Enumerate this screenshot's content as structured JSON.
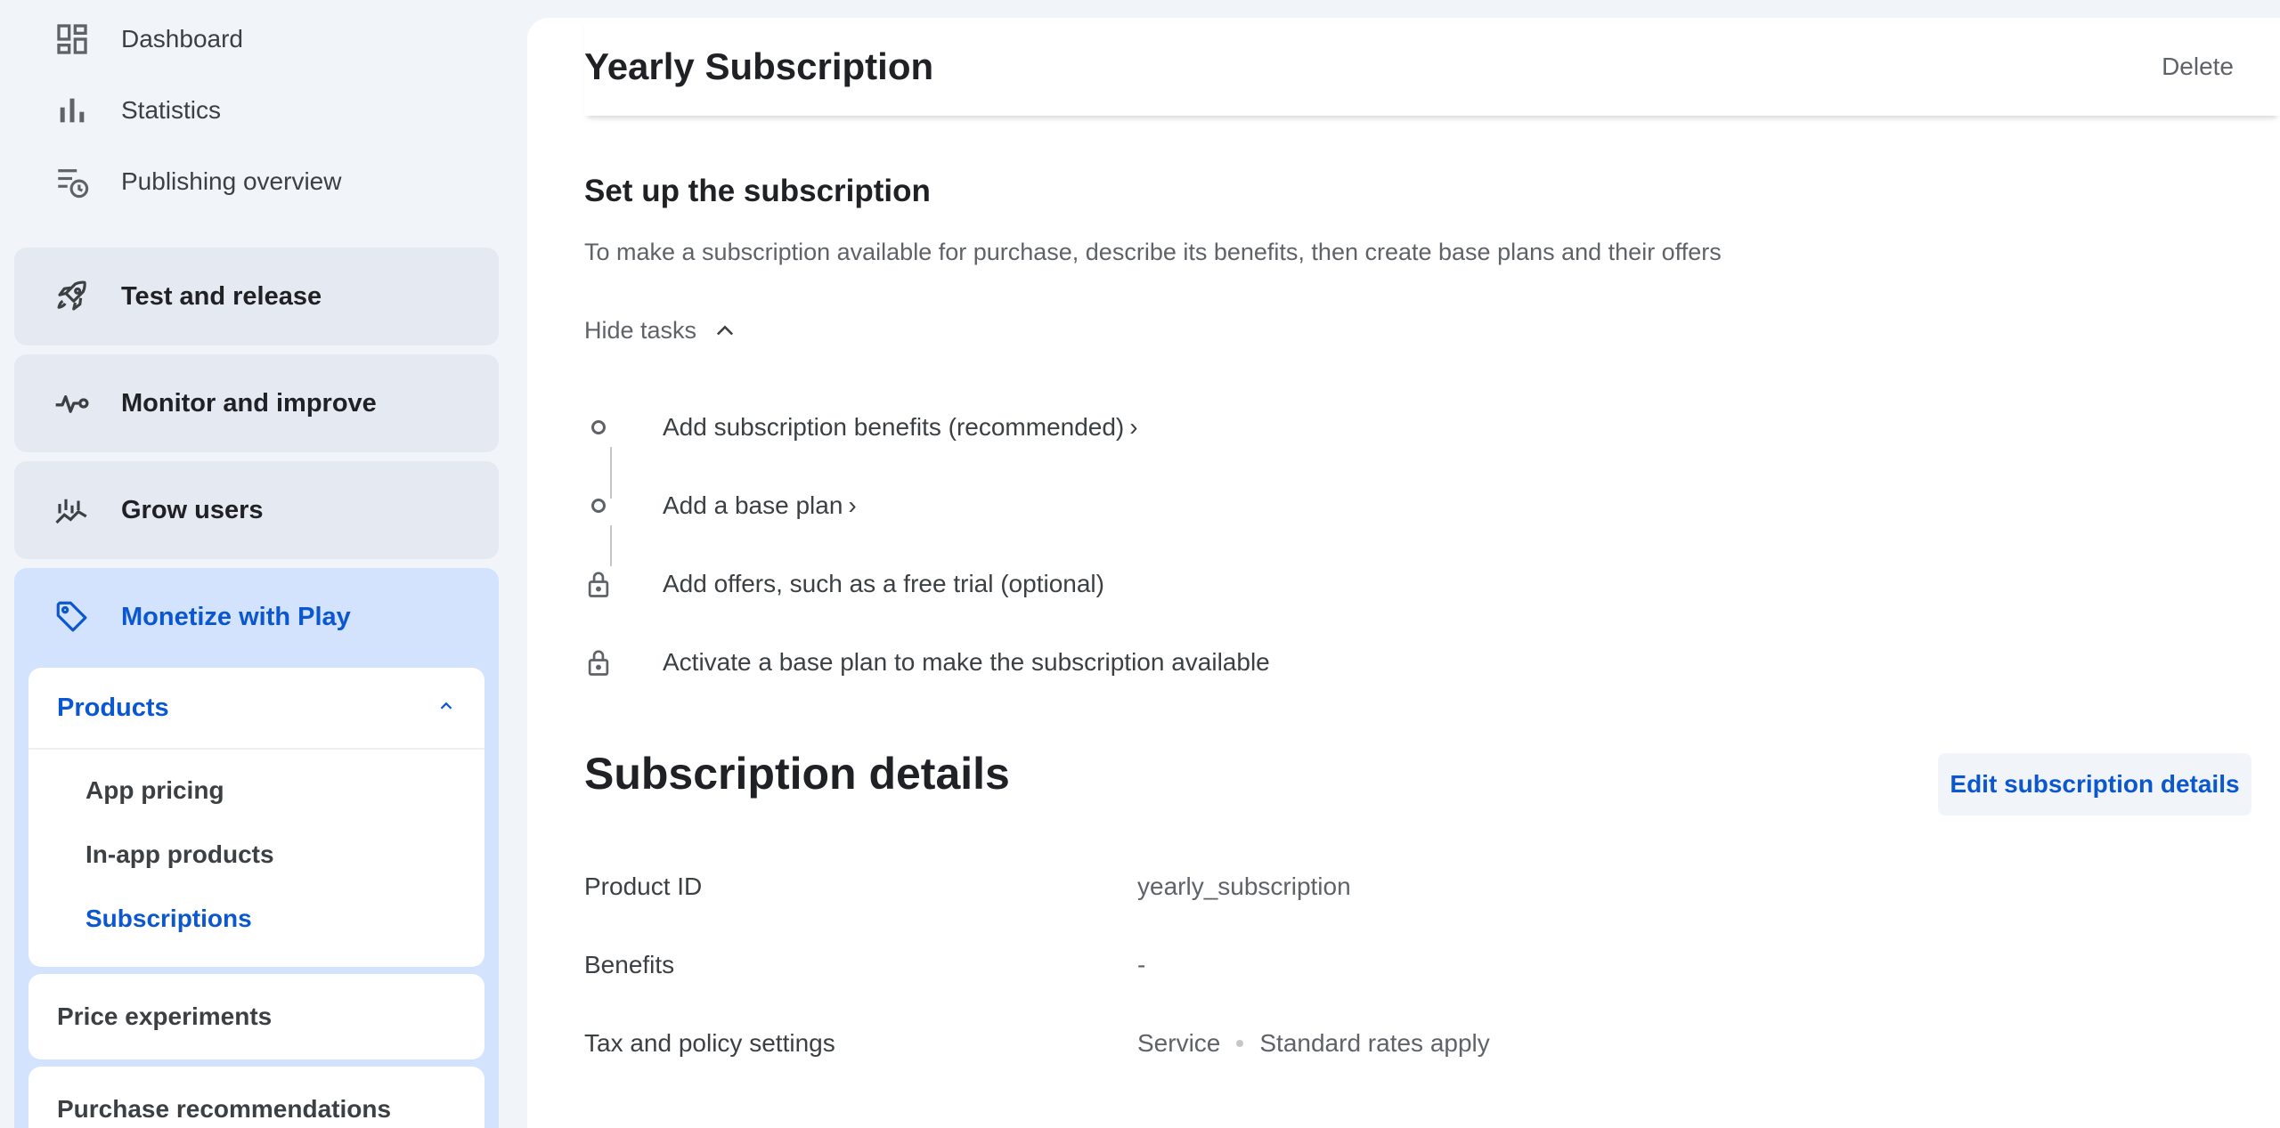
{
  "sidebar": {
    "top_items": [
      {
        "label": "Dashboard",
        "icon": "dashboard-icon"
      },
      {
        "label": "Statistics",
        "icon": "bar-chart-icon"
      },
      {
        "label": "Publishing overview",
        "icon": "publishing-history-icon"
      }
    ],
    "groups": [
      {
        "label": "Test and release",
        "icon": "rocket-icon"
      },
      {
        "label": "Monitor and improve",
        "icon": "pulse-icon"
      },
      {
        "label": "Grow users",
        "icon": "growth-chart-icon"
      },
      {
        "label": "Monetize with Play",
        "icon": "tag-icon"
      }
    ],
    "products": {
      "label": "Products",
      "items": [
        "App pricing",
        "In-app products",
        "Subscriptions"
      ],
      "selected": "Subscriptions"
    },
    "price_experiments": "Price experiments",
    "purchase_recommendations": "Purchase recommendations"
  },
  "header": {
    "title": "Yearly Subscription",
    "delete_label": "Delete"
  },
  "setup": {
    "title": "Set up the subscription",
    "description": "To make a subscription available for purchase, describe its benefits, then create base plans and their offers",
    "toggle_label": "Hide tasks",
    "tasks": [
      {
        "label": "Add subscription benefits (recommended)",
        "state": "open",
        "arrow": "›"
      },
      {
        "label": "Add a base plan",
        "state": "open",
        "arrow": "›"
      },
      {
        "label": "Add offers, such as a free trial (optional)",
        "state": "locked"
      },
      {
        "label": "Activate a base plan to make the subscription available",
        "state": "locked"
      }
    ]
  },
  "details": {
    "title": "Subscription details",
    "edit_label": "Edit subscription details",
    "rows": {
      "product_id": {
        "label": "Product ID",
        "value": "yearly_subscription"
      },
      "benefits": {
        "label": "Benefits",
        "value": "-"
      },
      "tax": {
        "label": "Tax and policy settings",
        "value_1": "Service",
        "value_2": "Standard rates apply"
      }
    }
  },
  "colors": {
    "accent": "#0b57d0",
    "active_bg": "#d3e3fd",
    "group_bg": "#e4e9f2",
    "page_bg": "#f1f4f9"
  }
}
